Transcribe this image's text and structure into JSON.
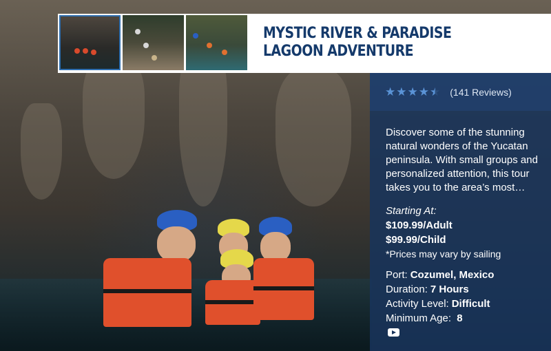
{
  "tour": {
    "title": "MYSTIC RIVER & PARADISE LAGOON ADVENTURE",
    "rating": 4.5,
    "reviews_label": "(141 Reviews)",
    "description": "Discover some of the stunning natural wonders of the Yucatan peninsula. With small groups and personalized attention, this tour takes you to the area’s most…",
    "pricing": {
      "starting_at_label": "Starting At:",
      "adult_price": "$109.99/Adult",
      "child_price": "$99.99/Child",
      "note": "*Prices may vary by sailing"
    },
    "details": [
      {
        "label": "Port:",
        "value": "Cozumel, Mexico"
      },
      {
        "label": "Duration:",
        "value": "7 Hours"
      },
      {
        "label": "Activity Level:",
        "value": "Difficult"
      },
      {
        "label": "Minimum Age:",
        "value": "8"
      }
    ],
    "thumbnails": [
      {
        "name": "cave-group-swim",
        "active": true
      },
      {
        "name": "cave-walkway",
        "active": false
      },
      {
        "name": "lagoon-swim",
        "active": false
      }
    ]
  },
  "colors": {
    "title": "#153a6b",
    "panel": "#18345c",
    "star": "#5a93d6",
    "thumb_active_border": "#2f6fb0"
  },
  "icons": {
    "rating": "star-icon",
    "video": "video-play-icon"
  }
}
